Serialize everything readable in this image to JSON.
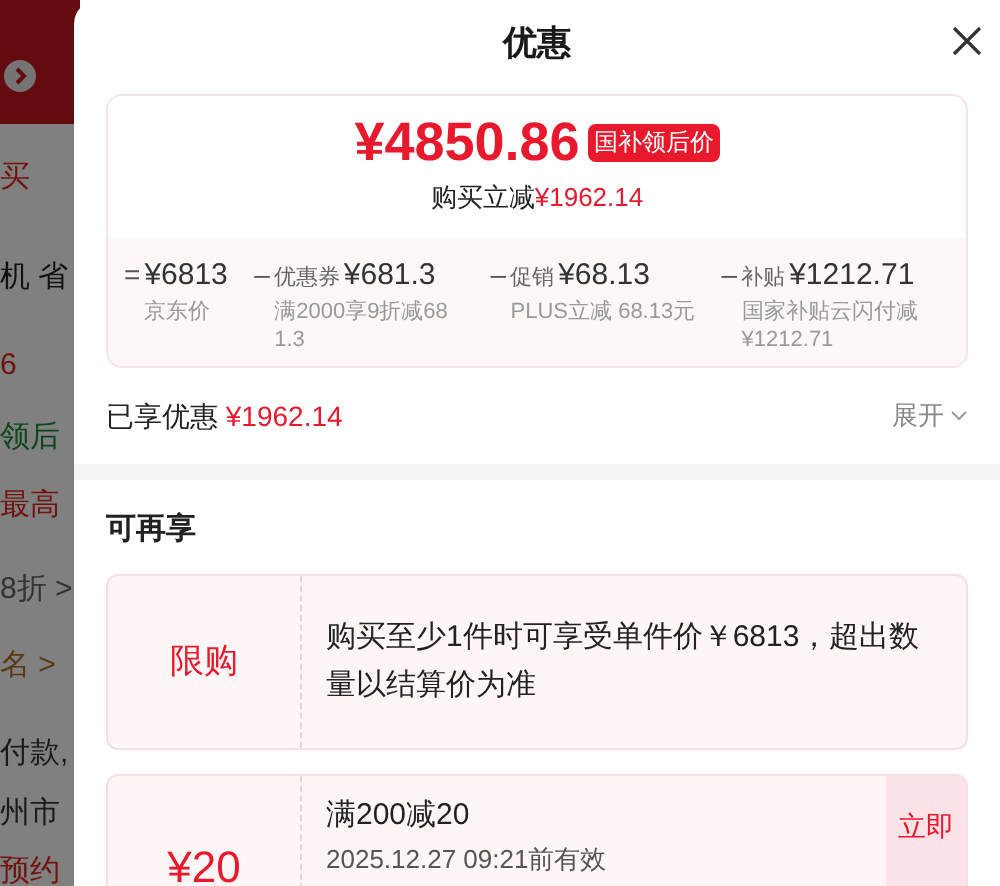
{
  "background_page": {
    "fragments": [
      {
        "text": "买",
        "color": "#71120d"
      },
      {
        "text": "机 省",
        "color": "#111111"
      },
      {
        "text": "6",
        "color": "#71120d"
      },
      {
        "text": "领后",
        "color": "#0d451d"
      },
      {
        "text": "最高",
        "color": "#71120d"
      },
      {
        "text": "8折 >",
        "color": "#333333"
      },
      {
        "text": "名 >",
        "color": "#583810"
      },
      {
        "text": "付款,",
        "color": "#1a1a1a"
      },
      {
        "text": "州市",
        "color": "#1a1a1a"
      },
      {
        "text": "预约",
        "color": "#71120d"
      }
    ]
  },
  "panel": {
    "title": "优惠",
    "price_card": {
      "price": "¥4850.86",
      "price_tag": "国补领后价",
      "saving_label": "购买立减",
      "saving_amount": "¥1962.14",
      "breakdown": [
        {
          "operator": "=",
          "amount": "¥6813",
          "note": "京东价"
        },
        {
          "operator": "–",
          "label": "优惠券",
          "amount": "¥681.3",
          "note": "满2000享9折减681.3"
        },
        {
          "operator": "–",
          "label": "促销",
          "amount": "¥68.13",
          "note": "PLUS立减 68.13元"
        },
        {
          "operator": "–",
          "label": "补贴",
          "amount": "¥1212.71",
          "note": "国家补贴云闪付减¥1212.71"
        }
      ]
    },
    "enjoyed": {
      "label": "已享优惠",
      "amount": "¥1962.14",
      "expand": "展开"
    },
    "more_section": {
      "title": "可再享",
      "offers": [
        {
          "kind": "limit",
          "left": "限购",
          "text": "购买至少1件时可享受单件价￥6813，超出数量以结算价为准"
        },
        {
          "kind": "coupon",
          "left": "¥20",
          "text": "满200减20",
          "validity": "2025.12.27 09:21前有效",
          "button": "立即"
        }
      ]
    }
  }
}
